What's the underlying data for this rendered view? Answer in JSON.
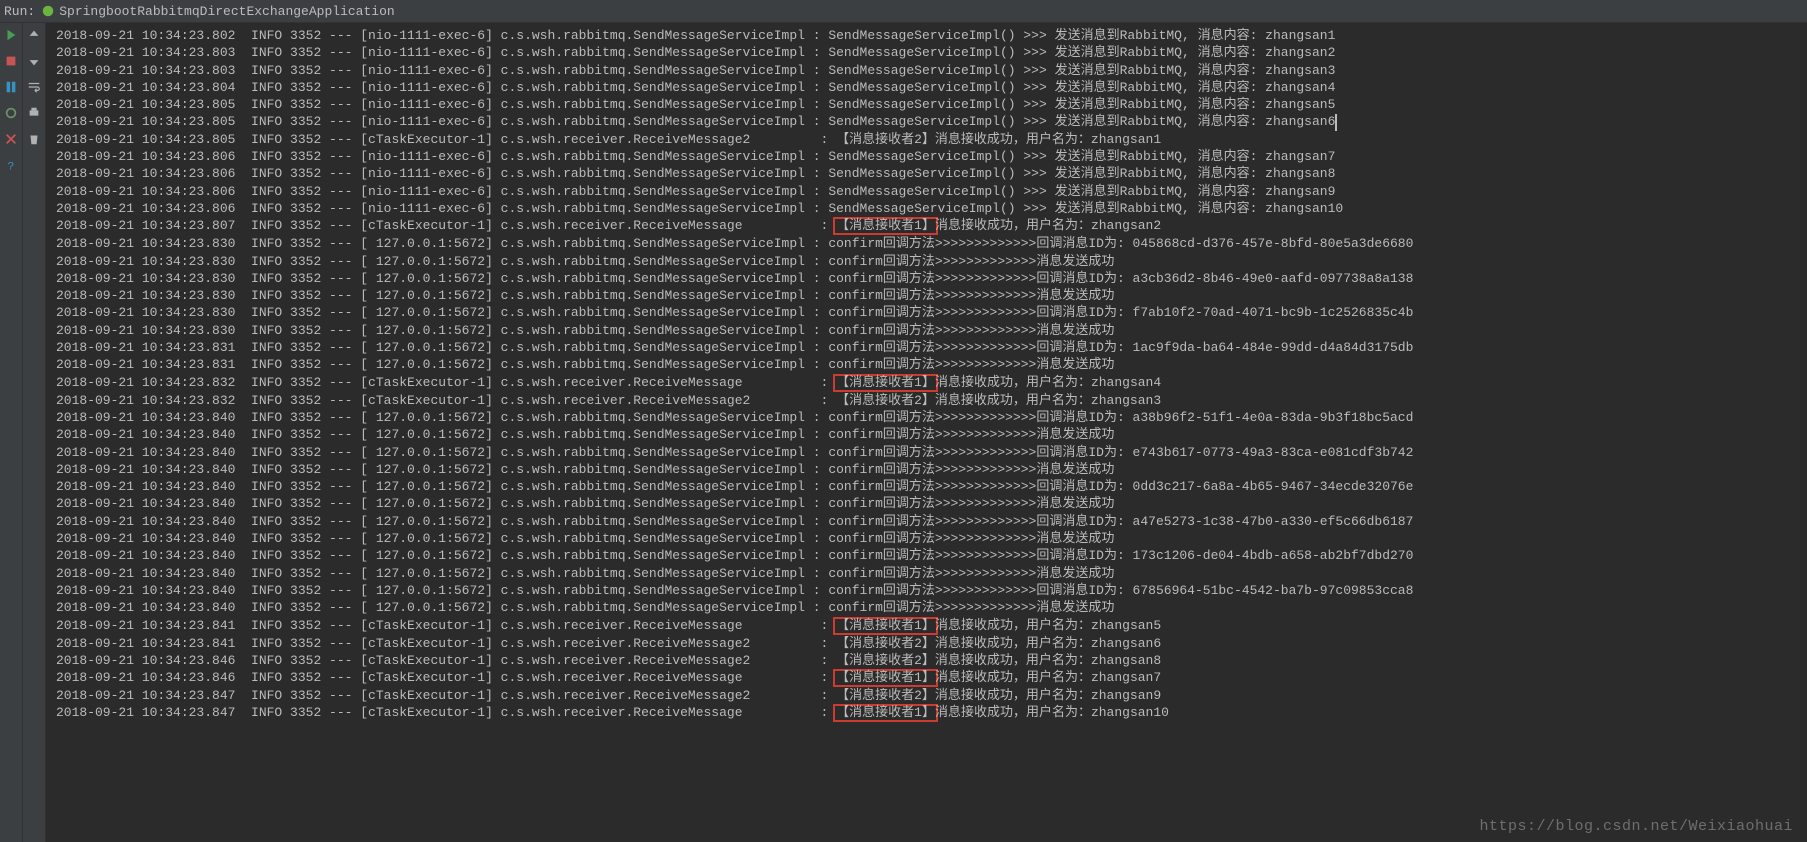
{
  "header": {
    "run_label": "Run:",
    "app_name": "SpringbootRabbitmqDirectExchangeApplication"
  },
  "watermark": "https://blog.csdn.net/Weixiaohuai",
  "icons_left": [
    "rerun",
    "stop-disabled",
    "pause",
    "frames",
    "skip"
  ],
  "icons_right": [
    "down",
    "print",
    "settings",
    "close",
    "help",
    "trash"
  ],
  "log": [
    {
      "ts": "2018-09-21 10:34:23.802",
      "lvl": "INFO",
      "pid": "3352",
      "thr": "[nio-1111-exec-6]",
      "cls": "c.s.wsh.rabbitmq.SendMessageServiceImpl",
      "msg": "SendMessageServiceImpl() >>> 发送消息到RabbitMQ, 消息内容: zhangsan1"
    },
    {
      "ts": "2018-09-21 10:34:23.803",
      "lvl": "INFO",
      "pid": "3352",
      "thr": "[nio-1111-exec-6]",
      "cls": "c.s.wsh.rabbitmq.SendMessageServiceImpl",
      "msg": "SendMessageServiceImpl() >>> 发送消息到RabbitMQ, 消息内容: zhangsan2"
    },
    {
      "ts": "2018-09-21 10:34:23.803",
      "lvl": "INFO",
      "pid": "3352",
      "thr": "[nio-1111-exec-6]",
      "cls": "c.s.wsh.rabbitmq.SendMessageServiceImpl",
      "msg": "SendMessageServiceImpl() >>> 发送消息到RabbitMQ, 消息内容: zhangsan3"
    },
    {
      "ts": "2018-09-21 10:34:23.804",
      "lvl": "INFO",
      "pid": "3352",
      "thr": "[nio-1111-exec-6]",
      "cls": "c.s.wsh.rabbitmq.SendMessageServiceImpl",
      "msg": "SendMessageServiceImpl() >>> 发送消息到RabbitMQ, 消息内容: zhangsan4"
    },
    {
      "ts": "2018-09-21 10:34:23.805",
      "lvl": "INFO",
      "pid": "3352",
      "thr": "[nio-1111-exec-6]",
      "cls": "c.s.wsh.rabbitmq.SendMessageServiceImpl",
      "msg": "SendMessageServiceImpl() >>> 发送消息到RabbitMQ, 消息内容: zhangsan5"
    },
    {
      "ts": "2018-09-21 10:34:23.805",
      "lvl": "INFO",
      "pid": "3352",
      "thr": "[nio-1111-exec-6]",
      "cls": "c.s.wsh.rabbitmq.SendMessageServiceImpl",
      "msg": "SendMessageServiceImpl() >>> 发送消息到RabbitMQ, 消息内容: zhangsan6",
      "caret": true
    },
    {
      "ts": "2018-09-21 10:34:23.805",
      "lvl": "INFO",
      "pid": "3352",
      "thr": "[cTaskExecutor-1]",
      "cls": "c.s.wsh.receiver.ReceiveMessage2",
      "pad": "         ",
      "msg": "【消息接收者2】消息接收成功，用户名为：zhangsan1"
    },
    {
      "ts": "2018-09-21 10:34:23.806",
      "lvl": "INFO",
      "pid": "3352",
      "thr": "[nio-1111-exec-6]",
      "cls": "c.s.wsh.rabbitmq.SendMessageServiceImpl",
      "msg": "SendMessageServiceImpl() >>> 发送消息到RabbitMQ, 消息内容: zhangsan7"
    },
    {
      "ts": "2018-09-21 10:34:23.806",
      "lvl": "INFO",
      "pid": "3352",
      "thr": "[nio-1111-exec-6]",
      "cls": "c.s.wsh.rabbitmq.SendMessageServiceImpl",
      "msg": "SendMessageServiceImpl() >>> 发送消息到RabbitMQ, 消息内容: zhangsan8"
    },
    {
      "ts": "2018-09-21 10:34:23.806",
      "lvl": "INFO",
      "pid": "3352",
      "thr": "[nio-1111-exec-6]",
      "cls": "c.s.wsh.rabbitmq.SendMessageServiceImpl",
      "msg": "SendMessageServiceImpl() >>> 发送消息到RabbitMQ, 消息内容: zhangsan9"
    },
    {
      "ts": "2018-09-21 10:34:23.806",
      "lvl": "INFO",
      "pid": "3352",
      "thr": "[nio-1111-exec-6]",
      "cls": "c.s.wsh.rabbitmq.SendMessageServiceImpl",
      "msg": "SendMessageServiceImpl() >>> 发送消息到RabbitMQ, 消息内容: zhangsan10"
    },
    {
      "ts": "2018-09-21 10:34:23.807",
      "lvl": "INFO",
      "pid": "3352",
      "thr": "[cTaskExecutor-1]",
      "cls": "c.s.wsh.receiver.ReceiveMessage",
      "pad": "          ",
      "hl": "【消息接收者1】",
      "msg2": "消息接收成功，用户名为：zhangsan2"
    },
    {
      "ts": "2018-09-21 10:34:23.830",
      "lvl": "INFO",
      "pid": "3352",
      "thr": "[ 127.0.0.1:5672]",
      "cls": "c.s.wsh.rabbitmq.SendMessageServiceImpl",
      "msg": "confirm回调方法>>>>>>>>>>>>>回调消息ID为: 045868cd-d376-457e-8bfd-80e5a3de6680"
    },
    {
      "ts": "2018-09-21 10:34:23.830",
      "lvl": "INFO",
      "pid": "3352",
      "thr": "[ 127.0.0.1:5672]",
      "cls": "c.s.wsh.rabbitmq.SendMessageServiceImpl",
      "msg": "confirm回调方法>>>>>>>>>>>>>消息发送成功"
    },
    {
      "ts": "2018-09-21 10:34:23.830",
      "lvl": "INFO",
      "pid": "3352",
      "thr": "[ 127.0.0.1:5672]",
      "cls": "c.s.wsh.rabbitmq.SendMessageServiceImpl",
      "msg": "confirm回调方法>>>>>>>>>>>>>回调消息ID为: a3cb36d2-8b46-49e0-aafd-097738a8a138"
    },
    {
      "ts": "2018-09-21 10:34:23.830",
      "lvl": "INFO",
      "pid": "3352",
      "thr": "[ 127.0.0.1:5672]",
      "cls": "c.s.wsh.rabbitmq.SendMessageServiceImpl",
      "msg": "confirm回调方法>>>>>>>>>>>>>消息发送成功"
    },
    {
      "ts": "2018-09-21 10:34:23.830",
      "lvl": "INFO",
      "pid": "3352",
      "thr": "[ 127.0.0.1:5672]",
      "cls": "c.s.wsh.rabbitmq.SendMessageServiceImpl",
      "msg": "confirm回调方法>>>>>>>>>>>>>回调消息ID为: f7ab10f2-70ad-4071-bc9b-1c2526835c4b"
    },
    {
      "ts": "2018-09-21 10:34:23.830",
      "lvl": "INFO",
      "pid": "3352",
      "thr": "[ 127.0.0.1:5672]",
      "cls": "c.s.wsh.rabbitmq.SendMessageServiceImpl",
      "msg": "confirm回调方法>>>>>>>>>>>>>消息发送成功"
    },
    {
      "ts": "2018-09-21 10:34:23.831",
      "lvl": "INFO",
      "pid": "3352",
      "thr": "[ 127.0.0.1:5672]",
      "cls": "c.s.wsh.rabbitmq.SendMessageServiceImpl",
      "msg": "confirm回调方法>>>>>>>>>>>>>回调消息ID为: 1ac9f9da-ba64-484e-99dd-d4a84d3175db"
    },
    {
      "ts": "2018-09-21 10:34:23.831",
      "lvl": "INFO",
      "pid": "3352",
      "thr": "[ 127.0.0.1:5672]",
      "cls": "c.s.wsh.rabbitmq.SendMessageServiceImpl",
      "msg": "confirm回调方法>>>>>>>>>>>>>消息发送成功"
    },
    {
      "ts": "2018-09-21 10:34:23.832",
      "lvl": "INFO",
      "pid": "3352",
      "thr": "[cTaskExecutor-1]",
      "cls": "c.s.wsh.receiver.ReceiveMessage",
      "pad": "          ",
      "hl": "【消息接收者1】",
      "msg2": "消息接收成功，用户名为：zhangsan4"
    },
    {
      "ts": "2018-09-21 10:34:23.832",
      "lvl": "INFO",
      "pid": "3352",
      "thr": "[cTaskExecutor-1]",
      "cls": "c.s.wsh.receiver.ReceiveMessage2",
      "pad": "         ",
      "msg": "【消息接收者2】消息接收成功，用户名为：zhangsan3"
    },
    {
      "ts": "2018-09-21 10:34:23.840",
      "lvl": "INFO",
      "pid": "3352",
      "thr": "[ 127.0.0.1:5672]",
      "cls": "c.s.wsh.rabbitmq.SendMessageServiceImpl",
      "msg": "confirm回调方法>>>>>>>>>>>>>回调消息ID为: a38b96f2-51f1-4e0a-83da-9b3f18bc5acd"
    },
    {
      "ts": "2018-09-21 10:34:23.840",
      "lvl": "INFO",
      "pid": "3352",
      "thr": "[ 127.0.0.1:5672]",
      "cls": "c.s.wsh.rabbitmq.SendMessageServiceImpl",
      "msg": "confirm回调方法>>>>>>>>>>>>>消息发送成功"
    },
    {
      "ts": "2018-09-21 10:34:23.840",
      "lvl": "INFO",
      "pid": "3352",
      "thr": "[ 127.0.0.1:5672]",
      "cls": "c.s.wsh.rabbitmq.SendMessageServiceImpl",
      "msg": "confirm回调方法>>>>>>>>>>>>>回调消息ID为: e743b617-0773-49a3-83ca-e081cdf3b742"
    },
    {
      "ts": "2018-09-21 10:34:23.840",
      "lvl": "INFO",
      "pid": "3352",
      "thr": "[ 127.0.0.1:5672]",
      "cls": "c.s.wsh.rabbitmq.SendMessageServiceImpl",
      "msg": "confirm回调方法>>>>>>>>>>>>>消息发送成功"
    },
    {
      "ts": "2018-09-21 10:34:23.840",
      "lvl": "INFO",
      "pid": "3352",
      "thr": "[ 127.0.0.1:5672]",
      "cls": "c.s.wsh.rabbitmq.SendMessageServiceImpl",
      "msg": "confirm回调方法>>>>>>>>>>>>>回调消息ID为: 0dd3c217-6a8a-4b65-9467-34ecde32076e"
    },
    {
      "ts": "2018-09-21 10:34:23.840",
      "lvl": "INFO",
      "pid": "3352",
      "thr": "[ 127.0.0.1:5672]",
      "cls": "c.s.wsh.rabbitmq.SendMessageServiceImpl",
      "msg": "confirm回调方法>>>>>>>>>>>>>消息发送成功"
    },
    {
      "ts": "2018-09-21 10:34:23.840",
      "lvl": "INFO",
      "pid": "3352",
      "thr": "[ 127.0.0.1:5672]",
      "cls": "c.s.wsh.rabbitmq.SendMessageServiceImpl",
      "msg": "confirm回调方法>>>>>>>>>>>>>回调消息ID为: a47e5273-1c38-47b0-a330-ef5c66db6187"
    },
    {
      "ts": "2018-09-21 10:34:23.840",
      "lvl": "INFO",
      "pid": "3352",
      "thr": "[ 127.0.0.1:5672]",
      "cls": "c.s.wsh.rabbitmq.SendMessageServiceImpl",
      "msg": "confirm回调方法>>>>>>>>>>>>>消息发送成功"
    },
    {
      "ts": "2018-09-21 10:34:23.840",
      "lvl": "INFO",
      "pid": "3352",
      "thr": "[ 127.0.0.1:5672]",
      "cls": "c.s.wsh.rabbitmq.SendMessageServiceImpl",
      "msg": "confirm回调方法>>>>>>>>>>>>>回调消息ID为: 173c1206-de04-4bdb-a658-ab2bf7dbd270"
    },
    {
      "ts": "2018-09-21 10:34:23.840",
      "lvl": "INFO",
      "pid": "3352",
      "thr": "[ 127.0.0.1:5672]",
      "cls": "c.s.wsh.rabbitmq.SendMessageServiceImpl",
      "msg": "confirm回调方法>>>>>>>>>>>>>消息发送成功"
    },
    {
      "ts": "2018-09-21 10:34:23.840",
      "lvl": "INFO",
      "pid": "3352",
      "thr": "[ 127.0.0.1:5672]",
      "cls": "c.s.wsh.rabbitmq.SendMessageServiceImpl",
      "msg": "confirm回调方法>>>>>>>>>>>>>回调消息ID为: 67856964-51bc-4542-ba7b-97c09853cca8"
    },
    {
      "ts": "2018-09-21 10:34:23.840",
      "lvl": "INFO",
      "pid": "3352",
      "thr": "[ 127.0.0.1:5672]",
      "cls": "c.s.wsh.rabbitmq.SendMessageServiceImpl",
      "msg": "confirm回调方法>>>>>>>>>>>>>消息发送成功"
    },
    {
      "ts": "2018-09-21 10:34:23.841",
      "lvl": "INFO",
      "pid": "3352",
      "thr": "[cTaskExecutor-1]",
      "cls": "c.s.wsh.receiver.ReceiveMessage",
      "pad": "          ",
      "hl": "【消息接收者1】",
      "msg2": "消息接收成功，用户名为：zhangsan5"
    },
    {
      "ts": "2018-09-21 10:34:23.841",
      "lvl": "INFO",
      "pid": "3352",
      "thr": "[cTaskExecutor-1]",
      "cls": "c.s.wsh.receiver.ReceiveMessage2",
      "pad": "         ",
      "msg": "【消息接收者2】消息接收成功，用户名为：zhangsan6"
    },
    {
      "ts": "2018-09-21 10:34:23.846",
      "lvl": "INFO",
      "pid": "3352",
      "thr": "[cTaskExecutor-1]",
      "cls": "c.s.wsh.receiver.ReceiveMessage2",
      "pad": "         ",
      "msg": "【消息接收者2】消息接收成功，用户名为：zhangsan8"
    },
    {
      "ts": "2018-09-21 10:34:23.846",
      "lvl": "INFO",
      "pid": "3352",
      "thr": "[cTaskExecutor-1]",
      "cls": "c.s.wsh.receiver.ReceiveMessage",
      "pad": "          ",
      "hl": "【消息接收者1】",
      "msg2": "消息接收成功，用户名为：zhangsan7"
    },
    {
      "ts": "2018-09-21 10:34:23.847",
      "lvl": "INFO",
      "pid": "3352",
      "thr": "[cTaskExecutor-1]",
      "cls": "c.s.wsh.receiver.ReceiveMessage2",
      "pad": "         ",
      "msg": "【消息接收者2】消息接收成功，用户名为：zhangsan9"
    },
    {
      "ts": "2018-09-21 10:34:23.847",
      "lvl": "INFO",
      "pid": "3352",
      "thr": "[cTaskExecutor-1]",
      "cls": "c.s.wsh.receiver.ReceiveMessage",
      "pad": "          ",
      "hl": "【消息接收者1】",
      "msg2": "消息接收成功，用户名为：zhangsan10"
    }
  ]
}
